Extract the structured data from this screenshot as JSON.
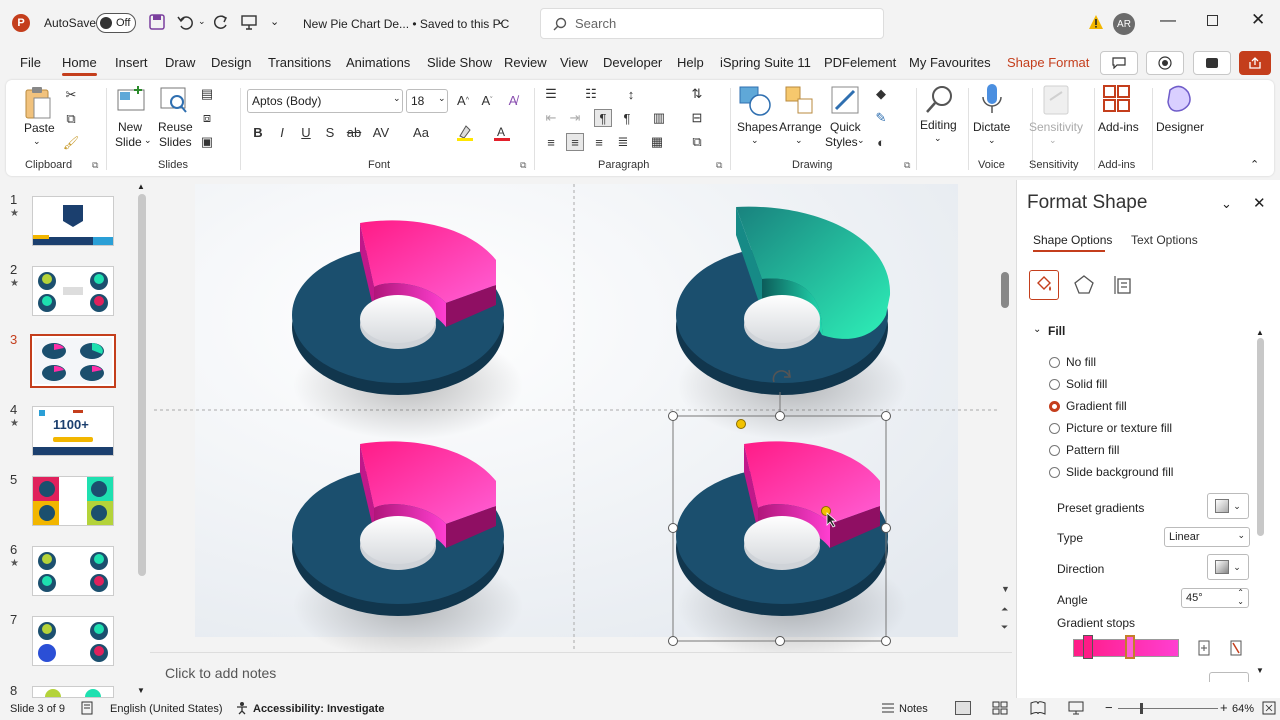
{
  "titlebar": {
    "autosave_label": "AutoSave",
    "autosave_state": "Off",
    "doc_title": "New Pie Chart De...  •  Saved to this PC",
    "search_placeholder": "Search",
    "user_initials": "AR"
  },
  "menu": {
    "tabs": [
      "File",
      "Home",
      "Insert",
      "Draw",
      "Design",
      "Transitions",
      "Animations",
      "Slide Show",
      "Review",
      "View",
      "Developer",
      "Help",
      "iSpring Suite 11",
      "PDFelement",
      "My Favourites",
      "Shape Format"
    ],
    "active": "Home"
  },
  "ribbon": {
    "clipboard": {
      "paste": "Paste",
      "group": "Clipboard"
    },
    "slides": {
      "new_slide_1": "New",
      "new_slide_2": "Slide",
      "reuse_1": "Reuse",
      "reuse_2": "Slides",
      "group": "Slides"
    },
    "font": {
      "family": "Aptos (Body)",
      "size": "18",
      "group": "Font"
    },
    "paragraph": {
      "group": "Paragraph"
    },
    "drawing": {
      "shapes": "Shapes",
      "arrange": "Arrange",
      "quick_1": "Quick",
      "quick_2": "Styles",
      "group": "Drawing"
    },
    "editing": {
      "label": "Editing"
    },
    "voice": {
      "dictate": "Dictate",
      "group": "Voice"
    },
    "sensitivity": {
      "label": "Sensitivity",
      "group": "Sensitivity"
    },
    "addins": {
      "label": "Add-ins",
      "group": "Add-ins"
    },
    "designer": {
      "label": "Designer"
    }
  },
  "thumbnails": [
    {
      "num": "1",
      "star": true
    },
    {
      "num": "2",
      "star": true
    },
    {
      "num": "3",
      "star": false,
      "selected": true
    },
    {
      "num": "4",
      "star": true,
      "text": "1100+"
    },
    {
      "num": "5",
      "star": false
    },
    {
      "num": "6",
      "star": true
    },
    {
      "num": "7",
      "star": false
    },
    {
      "num": "8",
      "star": false
    }
  ],
  "notes_placeholder": "Click to add notes",
  "format_pane": {
    "title": "Format Shape",
    "tab_shape": "Shape Options",
    "tab_text": "Text Options",
    "section": "Fill",
    "fill_options": [
      "No fill",
      "Solid fill",
      "Gradient fill",
      "Picture or texture fill",
      "Pattern fill",
      "Slide background fill"
    ],
    "selected_fill": "Gradient fill",
    "preset_label": "Preset gradients",
    "type_label": "Type",
    "type_value": "Linear",
    "direction_label": "Direction",
    "angle_label": "Angle",
    "angle_value": "45°",
    "stops_label": "Gradient stops"
  },
  "status": {
    "slide": "Slide 3 of 9",
    "language": "English (United States)",
    "accessibility": "Accessibility: Investigate",
    "notes": "Notes",
    "zoom": "64%"
  },
  "colors": {
    "accent": "#c43e1c",
    "donut_base": "#1b4f6e",
    "pink": "#ff2fa8",
    "teal": "#1ee0b0"
  }
}
